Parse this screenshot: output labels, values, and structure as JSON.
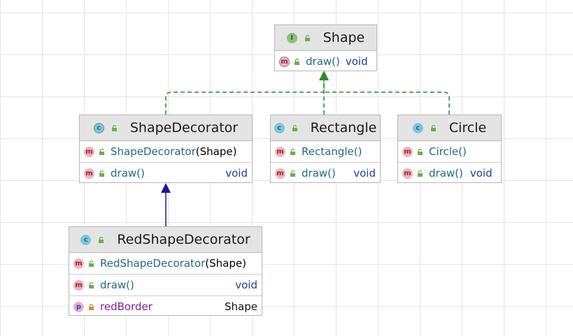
{
  "diagram": {
    "nodes": {
      "shape": {
        "kind": "interface",
        "badge": "I",
        "title": "Shape",
        "members": [
          {
            "badge": "m",
            "name": "draw()",
            "type": "void"
          }
        ]
      },
      "shape_decorator": {
        "kind": "abstract-class",
        "badge": "c",
        "title": "ShapeDecorator",
        "members": [
          {
            "badge": "m",
            "name": "ShapeDecorator",
            "args": "(Shape)"
          },
          {
            "badge": "m",
            "name": "draw()",
            "type": "void"
          }
        ]
      },
      "rectangle": {
        "kind": "class",
        "badge": "c",
        "title": "Rectangle",
        "members": [
          {
            "badge": "m",
            "name": "Rectangle()"
          },
          {
            "badge": "m",
            "name": "draw()",
            "type": "void"
          }
        ]
      },
      "circle": {
        "kind": "class",
        "badge": "c",
        "title": "Circle",
        "members": [
          {
            "badge": "m",
            "name": "Circle()"
          },
          {
            "badge": "m",
            "name": "draw()",
            "type": "void"
          }
        ]
      },
      "red_shape_decorator": {
        "kind": "class",
        "badge": "c",
        "title": "RedShapeDecorator",
        "members": [
          {
            "badge": "m",
            "name": "RedShapeDecorator",
            "args": "(Shape)"
          },
          {
            "badge": "m",
            "name": "draw()",
            "type": "void"
          },
          {
            "badge": "p",
            "name": "redBorder",
            "type": "Shape"
          }
        ]
      }
    },
    "edges": [
      {
        "from": "ShapeDecorator",
        "to": "Shape",
        "kind": "realization",
        "color": "#2a8a2a"
      },
      {
        "from": "Rectangle",
        "to": "Shape",
        "kind": "realization",
        "color": "#2a8a2a"
      },
      {
        "from": "Circle",
        "to": "Shape",
        "kind": "realization",
        "color": "#2a8a2a"
      },
      {
        "from": "RedShapeDecorator",
        "to": "ShapeDecorator",
        "kind": "generalization",
        "color": "#1a1a8c"
      }
    ]
  },
  "colors": {
    "header_bg": "#e4e4e4",
    "method_name": "#1e6c7c",
    "field_name": "#8b1c9c",
    "return_type": "#1c3fa0",
    "realization_edge": "#2a8a2a",
    "generalization_edge": "#1a1a8c"
  }
}
